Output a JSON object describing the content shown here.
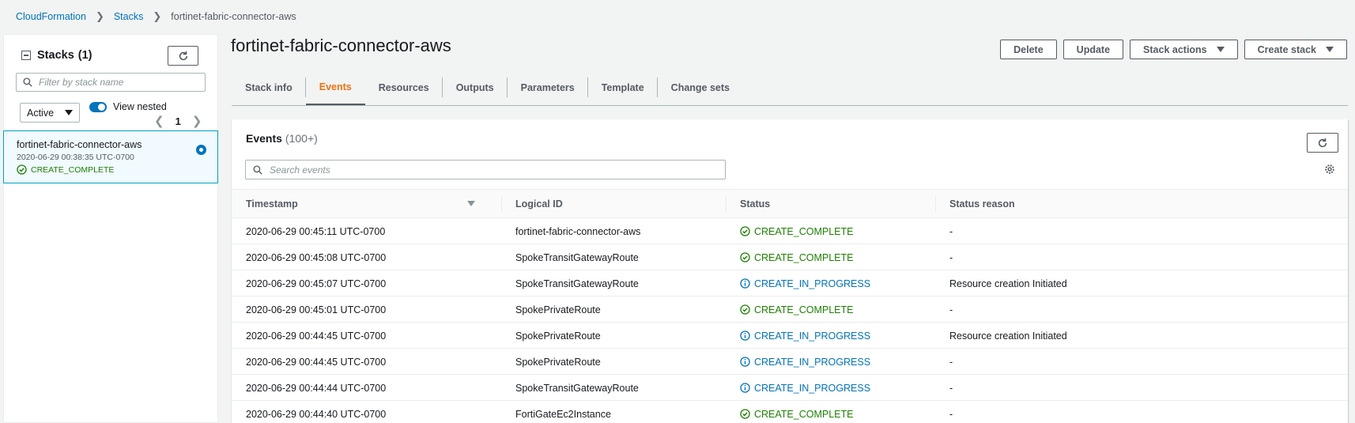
{
  "breadcrumb": {
    "items": [
      "CloudFormation",
      "Stacks"
    ],
    "current": "fortinet-fabric-connector-aws"
  },
  "sidebar": {
    "title": "Stacks",
    "count": "(1)",
    "filter_placeholder": "Filter by stack name",
    "filter_select": "Active",
    "toggle_label": "View nested",
    "page": "1",
    "stack": {
      "name": "fortinet-fabric-connector-aws",
      "date": "2020-06-29 00:38:35 UTC-0700",
      "status": "CREATE_COMPLETE"
    }
  },
  "page": {
    "title": "fortinet-fabric-connector-aws"
  },
  "actions": {
    "delete": "Delete",
    "update": "Update",
    "stack_actions": "Stack actions",
    "create_stack": "Create stack"
  },
  "tabs": [
    "Stack info",
    "Events",
    "Resources",
    "Outputs",
    "Parameters",
    "Template",
    "Change sets"
  ],
  "active_tab": "Events",
  "events": {
    "title": "Events",
    "count": "(100+)",
    "search_placeholder": "Search events",
    "columns": [
      "Timestamp",
      "Logical ID",
      "Status",
      "Status reason"
    ],
    "rows": [
      {
        "timestamp": "2020-06-29 00:45:11 UTC-0700",
        "logical_id": "fortinet-fabric-connector-aws",
        "status": "CREATE_COMPLETE",
        "reason": "-"
      },
      {
        "timestamp": "2020-06-29 00:45:08 UTC-0700",
        "logical_id": "SpokeTransitGatewayRoute",
        "status": "CREATE_COMPLETE",
        "reason": "-"
      },
      {
        "timestamp": "2020-06-29 00:45:07 UTC-0700",
        "logical_id": "SpokeTransitGatewayRoute",
        "status": "CREATE_IN_PROGRESS",
        "reason": "Resource creation Initiated"
      },
      {
        "timestamp": "2020-06-29 00:45:01 UTC-0700",
        "logical_id": "SpokePrivateRoute",
        "status": "CREATE_COMPLETE",
        "reason": "-"
      },
      {
        "timestamp": "2020-06-29 00:44:45 UTC-0700",
        "logical_id": "SpokePrivateRoute",
        "status": "CREATE_IN_PROGRESS",
        "reason": "Resource creation Initiated"
      },
      {
        "timestamp": "2020-06-29 00:44:45 UTC-0700",
        "logical_id": "SpokePrivateRoute",
        "status": "CREATE_IN_PROGRESS",
        "reason": "-"
      },
      {
        "timestamp": "2020-06-29 00:44:44 UTC-0700",
        "logical_id": "SpokeTransitGatewayRoute",
        "status": "CREATE_IN_PROGRESS",
        "reason": "-"
      },
      {
        "timestamp": "2020-06-29 00:44:40 UTC-0700",
        "logical_id": "FortiGateEc2Instance",
        "status": "CREATE_COMPLETE",
        "reason": "-"
      }
    ]
  },
  "colors": {
    "link": "#0073bb",
    "success": "#1d8102",
    "in_progress": "#0073bb",
    "active_tab": "#ec7211"
  },
  "icons": {
    "success": "check-circle-icon",
    "in_progress": "info-circle-icon",
    "refresh": "refresh-icon",
    "settings": "gear-icon",
    "search": "search-icon"
  }
}
